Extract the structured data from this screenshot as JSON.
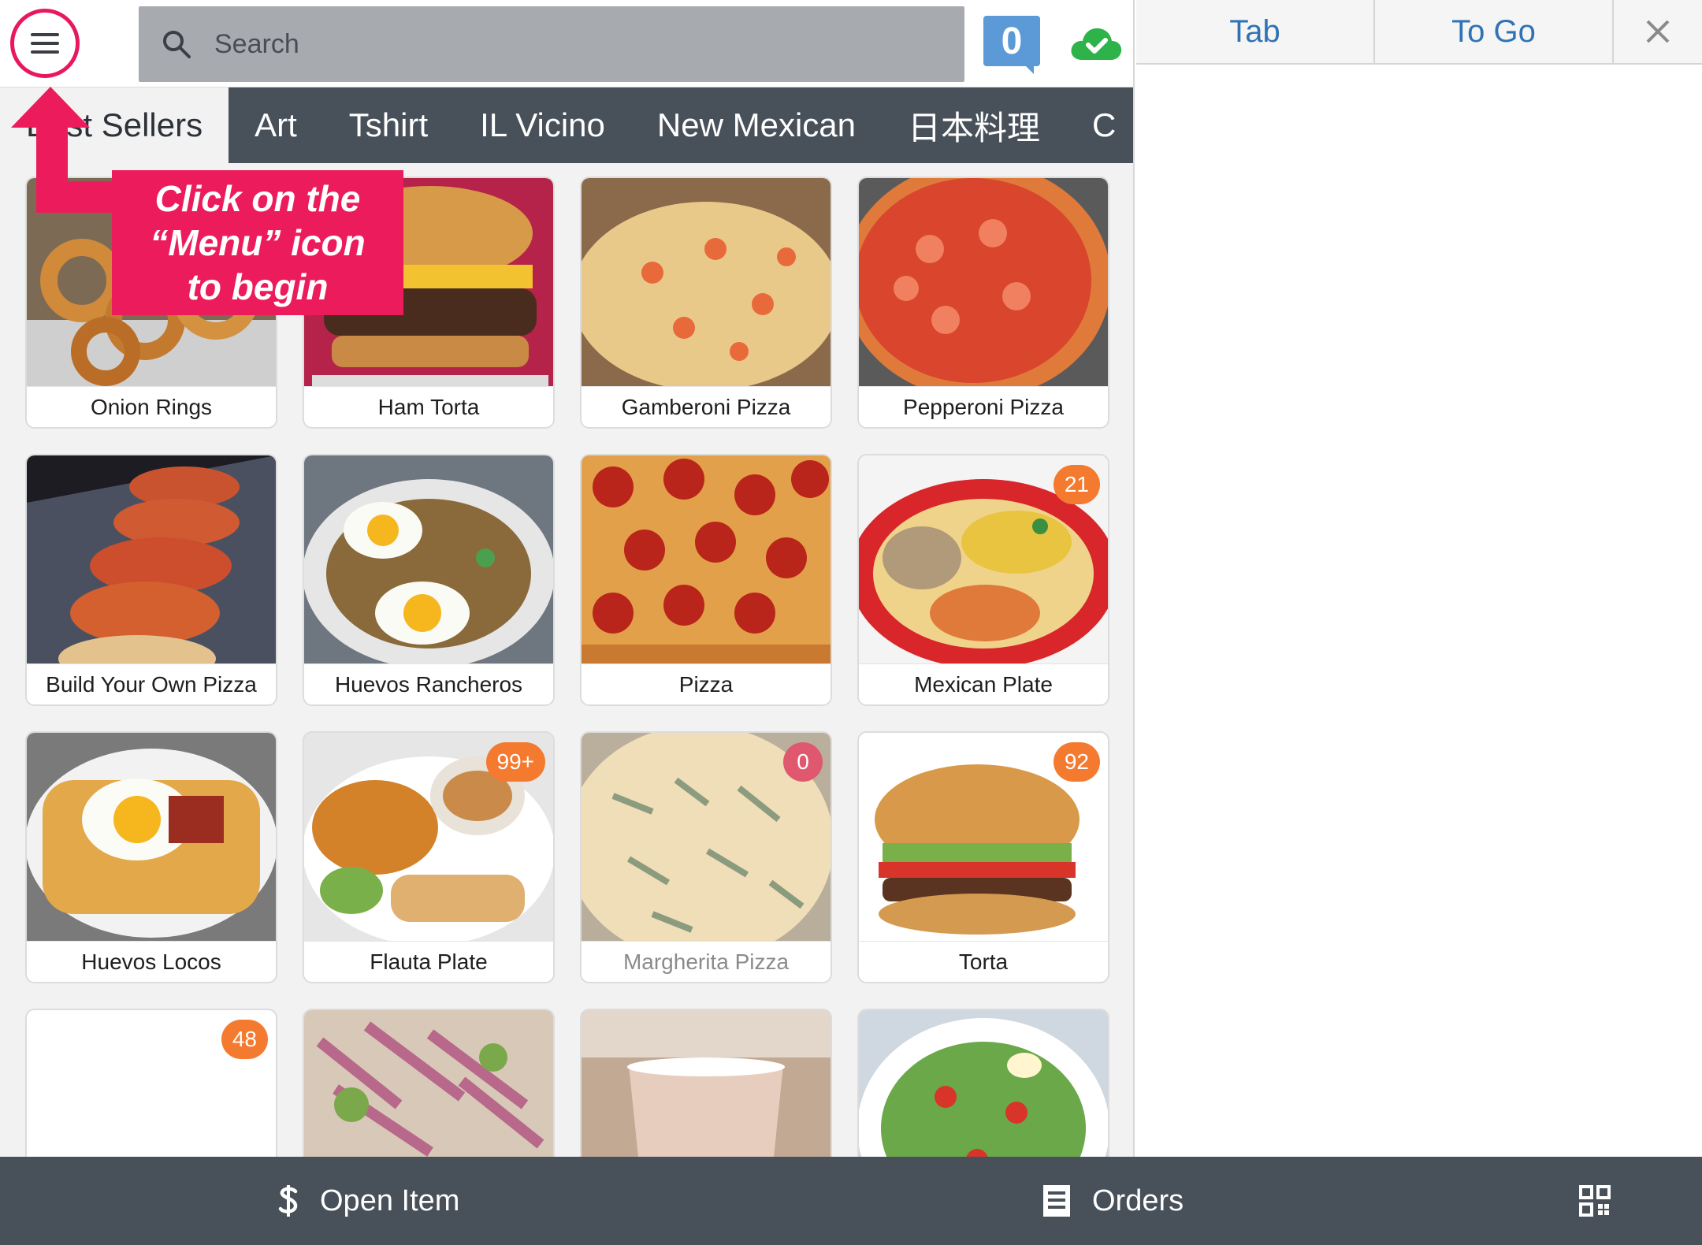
{
  "search": {
    "placeholder": "Search"
  },
  "cart": {
    "count": "0"
  },
  "icons": {
    "menu": "hamburger-menu-icon",
    "search": "search-icon",
    "cloud": "cloud-check-icon",
    "close": "close-icon",
    "dollar": "dollar-icon",
    "orders": "receipt-icon",
    "qr": "qr-code-icon"
  },
  "categories": [
    "Best Sellers",
    "Art",
    "Tshirt",
    "IL Vicino",
    "New Mexican",
    "日本料理",
    "C"
  ],
  "items": [
    {
      "name": "Onion Rings",
      "badge": ""
    },
    {
      "name": "Ham Torta",
      "badge": ""
    },
    {
      "name": "Gamberoni Pizza",
      "badge": ""
    },
    {
      "name": "Pepperoni Pizza",
      "badge": ""
    },
    {
      "name": "Build Your Own Pizza",
      "badge": ""
    },
    {
      "name": "Huevos Rancheros",
      "badge": ""
    },
    {
      "name": "Pizza",
      "badge": ""
    },
    {
      "name": "Mexican Plate",
      "badge": "21"
    },
    {
      "name": "Huevos Locos",
      "badge": ""
    },
    {
      "name": "Flauta Plate",
      "badge": "99+"
    },
    {
      "name": "Margherita Pizza",
      "badge": "0"
    },
    {
      "name": "Torta",
      "badge": "92"
    },
    {
      "name": "",
      "badge": "48"
    },
    {
      "name": "",
      "badge": ""
    },
    {
      "name": "",
      "badge": ""
    },
    {
      "name": "",
      "badge": ""
    }
  ],
  "tooltip": {
    "line1": "Click on the",
    "line2": "“Menu” icon",
    "line3": "to begin"
  },
  "order_panel": {
    "tab_label": "Tab",
    "togo_label": "To Go"
  },
  "bottom": {
    "open_item": "Open Item",
    "orders": "Orders"
  },
  "colors": {
    "accent": "#ec1c5c",
    "bar": "#48505a",
    "badge": "#f47a30",
    "badge_zero": "#e0586d",
    "tab_text": "#2f73b5",
    "cart": "#5b9ad6",
    "cloud": "#2eb24a"
  }
}
